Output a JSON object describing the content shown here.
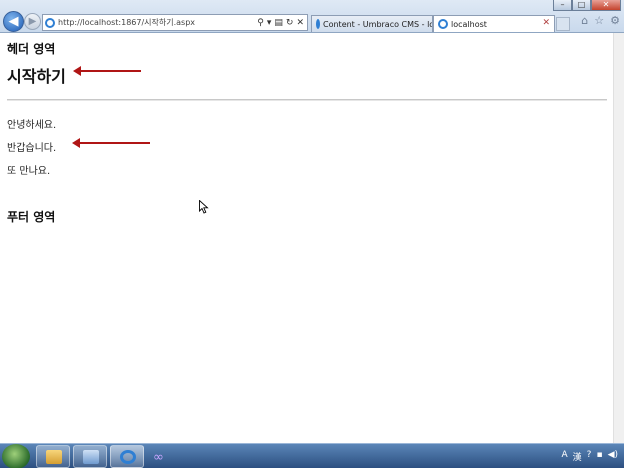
{
  "browser": {
    "address": "http://localhost:1867/시작하기.aspx",
    "tabs": [
      {
        "label": "Content - Umbraco CMS - lo..."
      },
      {
        "label": "localhost"
      }
    ]
  },
  "page": {
    "header": "헤더 영역",
    "title": "시작하기",
    "paragraphs": [
      "안녕하세요.",
      "반갑습니다.",
      "또 만나요."
    ],
    "footer": "푸터 영역"
  },
  "colors": {
    "annotation_arrow": "#b01515",
    "taskbar": "#2c4f80"
  }
}
